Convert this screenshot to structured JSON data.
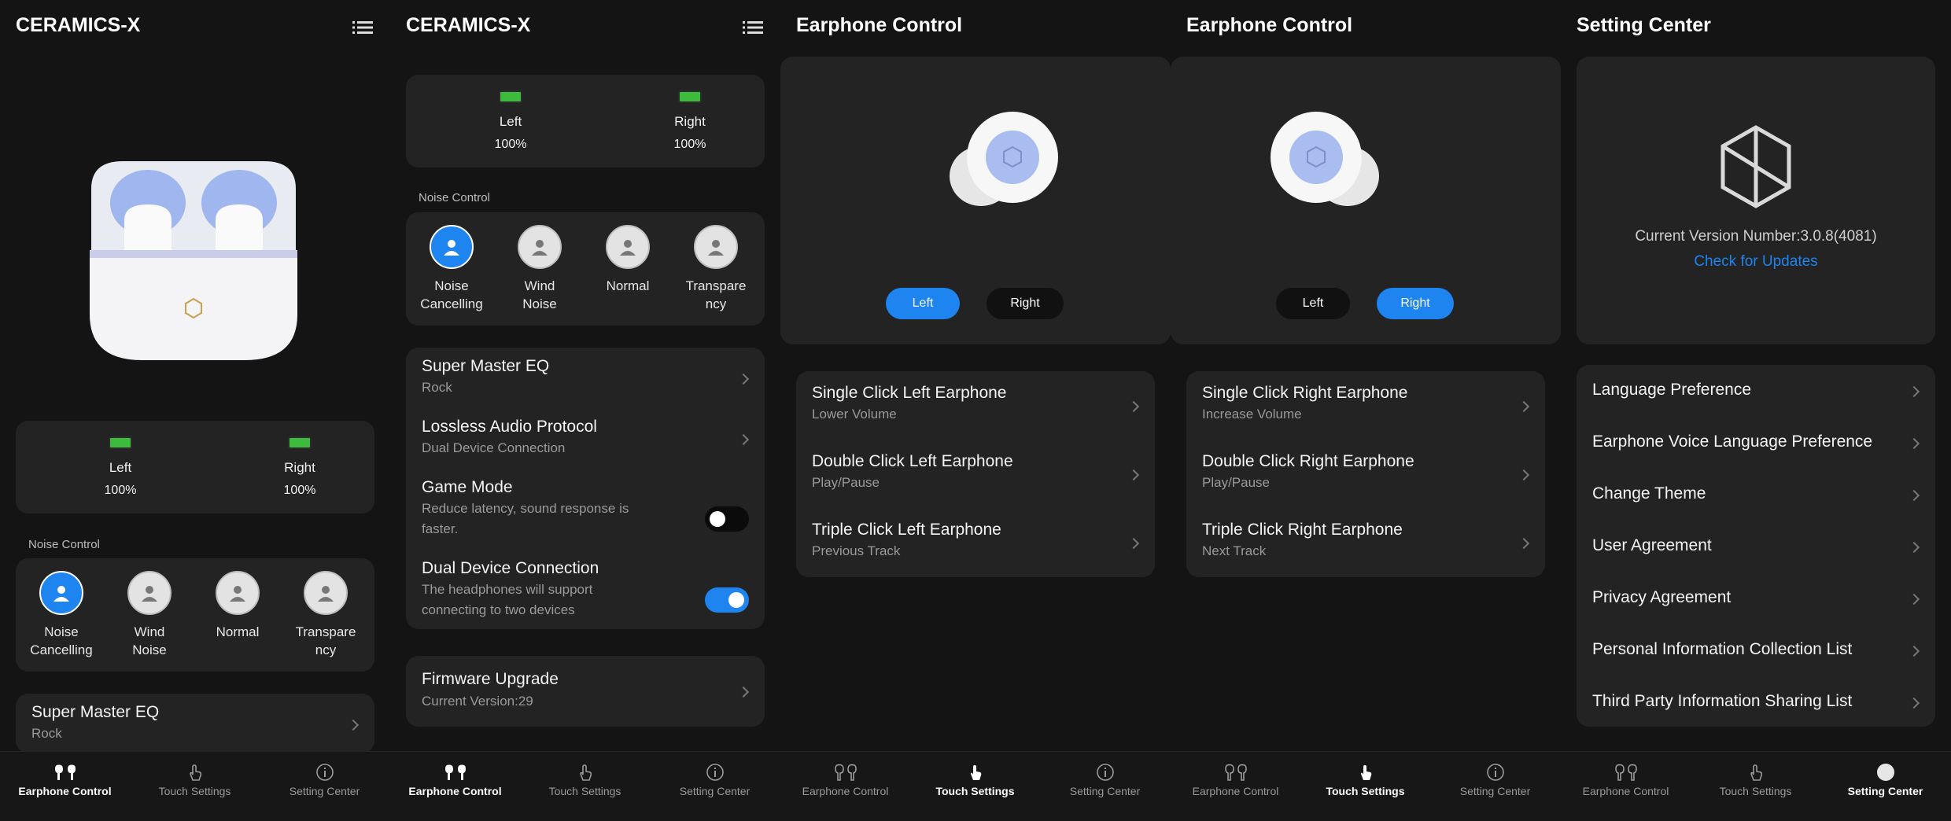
{
  "app_title": "CERAMICS-X",
  "earphone_control_title": "Earphone Control",
  "setting_center_title": "Setting Center",
  "battery": {
    "left_label": "Left",
    "left_pct": "100%",
    "right_label": "Right",
    "right_pct": "100%"
  },
  "noise_control": {
    "label": "Noise Control",
    "items": [
      {
        "label1": "Noise",
        "label2": "Cancelling"
      },
      {
        "label1": "Wind",
        "label2": "Noise"
      },
      {
        "label1": "Normal",
        "label2": ""
      },
      {
        "label1": "Transpare",
        "label2": "ncy"
      }
    ]
  },
  "eq": {
    "title": "Super Master EQ",
    "value": "Rock"
  },
  "lossless": {
    "title": "Lossless Audio Protocol",
    "value": "Dual Device Connection"
  },
  "game_mode": {
    "title": "Game Mode",
    "desc1": "Reduce latency, sound response is",
    "desc2": "faster.",
    "enabled": false
  },
  "dual_device": {
    "title": "Dual Device Connection",
    "desc1": "The headphones will support",
    "desc2": "connecting to two devices",
    "enabled": true
  },
  "firmware": {
    "title": "Firmware Upgrade",
    "value": "Current Version:29"
  },
  "side_toggle": {
    "left": "Left",
    "right": "Right"
  },
  "left_touch": [
    {
      "title": "Single Click Left Earphone",
      "value": "Lower Volume"
    },
    {
      "title": "Double Click Left Earphone",
      "value": "Play/Pause"
    },
    {
      "title": "Triple Click Left Earphone",
      "value": "Previous Track"
    }
  ],
  "right_touch": [
    {
      "title": "Single Click Right Earphone",
      "value": "Increase Volume"
    },
    {
      "title": "Double Click Right Earphone",
      "value": "Play/Pause"
    },
    {
      "title": "Triple Click Right Earphone",
      "value": "Next Track"
    }
  ],
  "version": {
    "text": "Current Version Number:3.0.8(4081)",
    "check": "Check for Updates"
  },
  "settings": [
    "Language Preference",
    "Earphone Voice Language Preference",
    "Change Theme",
    "User Agreement",
    "Privacy Agreement",
    "Personal Information Collection List",
    "Third Party Information Sharing List"
  ],
  "nav": {
    "earphone": "Earphone Control",
    "touch": "Touch Settings",
    "setting": "Setting Center"
  },
  "colors": {
    "accent": "#1e84f0",
    "battery": "#3dbb3d",
    "card": "#232323"
  }
}
